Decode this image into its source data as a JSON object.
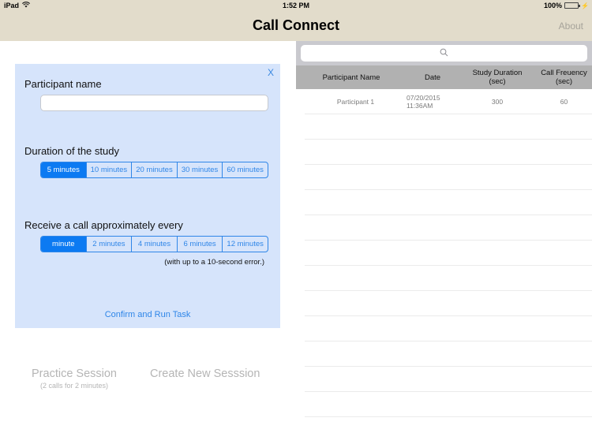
{
  "status_bar": {
    "device": "iPad",
    "wifi_icon": "wifi-icon",
    "time": "1:52 PM",
    "battery_percent": "100%",
    "battery_level": 1.0,
    "charging_icon": "charging-bolt-icon"
  },
  "nav": {
    "title": "Call Connect",
    "about_label": "About"
  },
  "form": {
    "close_label": "X",
    "participant_label": "Participant name",
    "participant_value": "",
    "participant_placeholder": "",
    "duration_label": "Duration of the study",
    "duration_options": [
      "5 minutes",
      "10 minutes",
      "20 minutes",
      "30 minutes",
      "60 minutes"
    ],
    "duration_selected": "5 minutes",
    "frequency_label": "Receive a call approximately every",
    "frequency_options": [
      "minute",
      "2 minutes",
      "4 minutes",
      "6 minutes",
      "12 minutes"
    ],
    "frequency_selected": "minute",
    "error_note": "(with up to a 10-second error.)",
    "confirm_label": "Confirm and Run Task"
  },
  "actions": {
    "practice_label": "Practice Session",
    "practice_sub": "(2 calls for 2 minutes)",
    "create_label": "Create New Sesssion"
  },
  "table": {
    "search_placeholder": "",
    "search_icon": "search-icon",
    "headers": [
      "Participant Name",
      "Date",
      "Study Duration\n(sec)",
      "Call Freuency\n(sec)"
    ],
    "header_lines": [
      [
        "Participant Name"
      ],
      [
        "Date"
      ],
      [
        "Study Duration",
        "(sec)"
      ],
      [
        "Call Freuency",
        "(sec)"
      ]
    ],
    "rows": [
      [
        "Participant 1",
        "07/20/2015 11:36AM",
        "300",
        "60"
      ]
    ],
    "empty_row_count": 12
  },
  "colors": {
    "nav_bg": "#e2dccb",
    "accent": "#0c7af2",
    "panel_bg": "#d6e4fb",
    "table_header_bg": "#b1b1b1"
  }
}
